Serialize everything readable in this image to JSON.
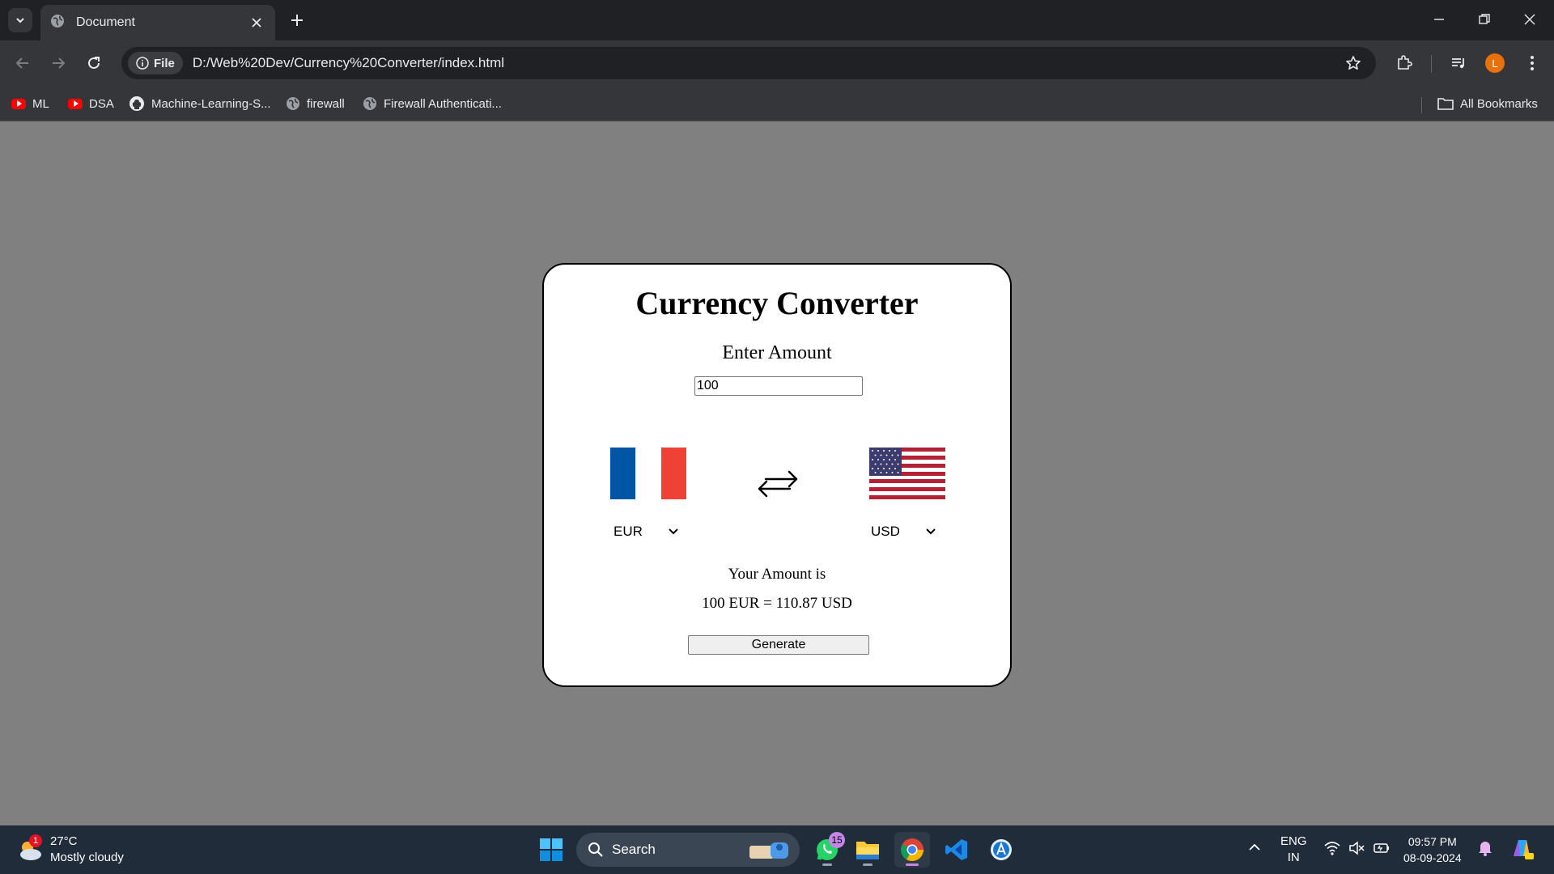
{
  "browser": {
    "tab_title": "Document",
    "site_chip": "File",
    "url": "D:/Web%20Dev/Currency%20Converter/index.html",
    "profile_initial": "L",
    "bookmarks": [
      {
        "label": "ML",
        "icon": "youtube-icon"
      },
      {
        "label": "DSA",
        "icon": "youtube-icon"
      },
      {
        "label": "Machine-Learning-S...",
        "icon": "github-icon"
      },
      {
        "label": "firewall",
        "icon": "globe-icon"
      },
      {
        "label": "Firewall Authenticati...",
        "icon": "globe-icon"
      }
    ],
    "all_bookmarks": "All Bookmarks"
  },
  "app": {
    "title": "Currency Converter",
    "amount_label": "Enter Amount",
    "amount_value": "100",
    "from_currency": "EUR",
    "to_currency": "USD",
    "result_label": "Your Amount is",
    "result_value": "100 EUR = 110.87 USD",
    "generate_label": "Generate",
    "from_flag": "france-flag",
    "to_flag": "us-flag"
  },
  "taskbar": {
    "weather_temp": "27°C",
    "weather_desc": "Mostly cloudy",
    "weather_badge": "1",
    "search_label": "Search",
    "whatsapp_badge": "15",
    "lang_top": "ENG",
    "lang_bottom": "IN",
    "time": "09:57 PM",
    "date": "08-09-2024"
  },
  "colors": {
    "page_background": "#808080",
    "card_background": "#ffffff",
    "france_blue": "#0055a4",
    "france_red": "#ef4135",
    "us_red": "#b22234",
    "us_blue": "#3c3b6e",
    "profile": "#e8710a"
  }
}
